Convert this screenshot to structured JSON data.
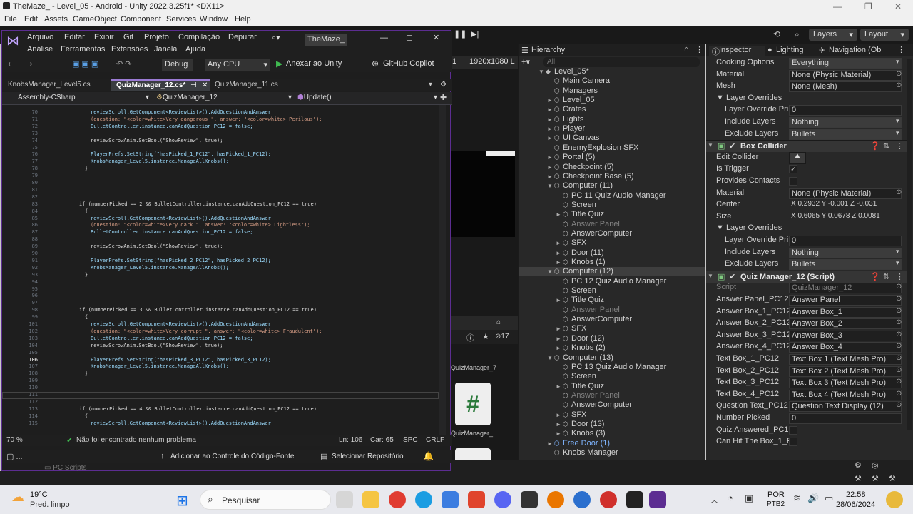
{
  "unity": {
    "title": "TheMaze_ - Level_05 - Android - Unity 2022.3.25f1* <DX11>",
    "menu": [
      "File",
      "Edit",
      "Assets",
      "GameObject",
      "Component",
      "Services",
      "Window",
      "Help"
    ],
    "layers": "Layers",
    "layout": "Layout",
    "resolution": "1920x1080 L",
    "count_badge": "17",
    "project_items": [
      "QuizManager_7",
      "QuizManager_...",
      "PC Scripts"
    ]
  },
  "hierarchy": {
    "tab": "Hierarchy",
    "search_placeholder": "All",
    "items": [
      {
        "label": "Level_05*",
        "indent": 0,
        "arrow": "▼",
        "style": "scene"
      },
      {
        "label": "Main Camera",
        "indent": 1,
        "arrow": "",
        "style": "normal"
      },
      {
        "label": "Managers",
        "indent": 1,
        "arrow": "",
        "style": "normal"
      },
      {
        "label": "Level_05",
        "indent": 1,
        "arrow": "►",
        "style": "normal"
      },
      {
        "label": "Crates",
        "indent": 1,
        "arrow": "►",
        "style": "normal"
      },
      {
        "label": "Lights",
        "indent": 1,
        "arrow": "►",
        "style": "normal"
      },
      {
        "label": "Player",
        "indent": 1,
        "arrow": "►",
        "style": "normal"
      },
      {
        "label": "UI Canvas",
        "indent": 1,
        "arrow": "►",
        "style": "normal"
      },
      {
        "label": "EnemyExplosion SFX",
        "indent": 1,
        "arrow": "",
        "style": "normal"
      },
      {
        "label": "Portal (5)",
        "indent": 1,
        "arrow": "►",
        "style": "normal"
      },
      {
        "label": "Checkpoint (5)",
        "indent": 1,
        "arrow": "►",
        "style": "normal"
      },
      {
        "label": "Checkpoint Base (5)",
        "indent": 1,
        "arrow": "►",
        "style": "normal"
      },
      {
        "label": "Computer (11)",
        "indent": 1,
        "arrow": "▼",
        "style": "normal"
      },
      {
        "label": "PC 11 Quiz Audio Manager",
        "indent": 2,
        "arrow": "",
        "style": "normal"
      },
      {
        "label": "Screen",
        "indent": 2,
        "arrow": "",
        "style": "normal"
      },
      {
        "label": "Title Quiz",
        "indent": 2,
        "arrow": "►",
        "style": "normal"
      },
      {
        "label": "Answer Panel",
        "indent": 2,
        "arrow": "",
        "style": "dim"
      },
      {
        "label": "AnswerComputer",
        "indent": 2,
        "arrow": "",
        "style": "normal"
      },
      {
        "label": "SFX",
        "indent": 2,
        "arrow": "►",
        "style": "normal"
      },
      {
        "label": "Door (11)",
        "indent": 2,
        "arrow": "►",
        "style": "normal"
      },
      {
        "label": "Knobs (1)",
        "indent": 2,
        "arrow": "►",
        "style": "normal"
      },
      {
        "label": "Computer (12)",
        "indent": 1,
        "arrow": "▼",
        "style": "selected"
      },
      {
        "label": "PC 12 Quiz Audio Manager",
        "indent": 2,
        "arrow": "",
        "style": "normal"
      },
      {
        "label": "Screen",
        "indent": 2,
        "arrow": "",
        "style": "normal"
      },
      {
        "label": "Title Quiz",
        "indent": 2,
        "arrow": "►",
        "style": "normal"
      },
      {
        "label": "Answer Panel",
        "indent": 2,
        "arrow": "",
        "style": "dim"
      },
      {
        "label": "AnswerComputer",
        "indent": 2,
        "arrow": "",
        "style": "normal"
      },
      {
        "label": "SFX",
        "indent": 2,
        "arrow": "►",
        "style": "normal"
      },
      {
        "label": "Door (12)",
        "indent": 2,
        "arrow": "►",
        "style": "normal"
      },
      {
        "label": "Knobs (2)",
        "indent": 2,
        "arrow": "►",
        "style": "normal"
      },
      {
        "label": "Computer (13)",
        "indent": 1,
        "arrow": "▼",
        "style": "normal"
      },
      {
        "label": "PC 13 Quiz Audio Manager",
        "indent": 2,
        "arrow": "",
        "style": "normal"
      },
      {
        "label": "Screen",
        "indent": 2,
        "arrow": "",
        "style": "normal"
      },
      {
        "label": "Title Quiz",
        "indent": 2,
        "arrow": "►",
        "style": "normal"
      },
      {
        "label": "Answer Panel",
        "indent": 2,
        "arrow": "",
        "style": "dim"
      },
      {
        "label": "AnswerComputer",
        "indent": 2,
        "arrow": "",
        "style": "normal"
      },
      {
        "label": "SFX",
        "indent": 2,
        "arrow": "►",
        "style": "normal"
      },
      {
        "label": "Door (13)",
        "indent": 2,
        "arrow": "►",
        "style": "normal"
      },
      {
        "label": "Knobs (3)",
        "indent": 2,
        "arrow": "►",
        "style": "normal"
      },
      {
        "label": "Free Door (1)",
        "indent": 1,
        "arrow": "►",
        "style": "prefab"
      },
      {
        "label": "Knobs Manager",
        "indent": 1,
        "arrow": "",
        "style": "normal"
      }
    ]
  },
  "inspector": {
    "tabs": [
      "Inspector",
      "Lighting",
      "Navigation (Ob"
    ],
    "rows": [
      {
        "label": "Cooking Options",
        "value": "Everything",
        "kind": "dropdown",
        "indent": 0
      },
      {
        "label": "Material",
        "value": "None (Physic Material)",
        "kind": "object",
        "indent": 0
      },
      {
        "label": "Mesh",
        "value": "None (Mesh)",
        "kind": "object",
        "indent": 0
      },
      {
        "label": "▼ Layer Overrides",
        "value": "",
        "kind": "header",
        "indent": 0
      },
      {
        "label": "Layer Override Pri",
        "value": "0",
        "kind": "text",
        "indent": 1
      },
      {
        "label": "Include Layers",
        "value": "Nothing",
        "kind": "dropdown",
        "indent": 1
      },
      {
        "label": "Exclude Layers",
        "value": "Bullets",
        "kind": "dropdown",
        "indent": 1
      },
      {
        "label": "Box Collider",
        "value": "",
        "kind": "component",
        "indent": 0
      },
      {
        "label": "Edit Collider",
        "value": "",
        "kind": "editbtn",
        "indent": 0
      },
      {
        "label": "Is Trigger",
        "value": "✓",
        "kind": "check",
        "indent": 0
      },
      {
        "label": "Provides Contacts",
        "value": "",
        "kind": "check",
        "indent": 0
      },
      {
        "label": "Material",
        "value": "None (Physic Material)",
        "kind": "object",
        "indent": 0
      },
      {
        "label": "Center",
        "value": "X 0.2932  Y -0.001  Z -0.031",
        "kind": "vector",
        "indent": 0
      },
      {
        "label": "Size",
        "value": "X 0.6065  Y 0.0678  Z 0.0081",
        "kind": "vector",
        "indent": 0
      },
      {
        "label": "▼ Layer Overrides",
        "value": "",
        "kind": "header",
        "indent": 0
      },
      {
        "label": "Layer Override Pri",
        "value": "0",
        "kind": "text",
        "indent": 1
      },
      {
        "label": "Include Layers",
        "value": "Nothing",
        "kind": "dropdown",
        "indent": 1
      },
      {
        "label": "Exclude Layers",
        "value": "Bullets",
        "kind": "dropdown",
        "indent": 1
      },
      {
        "label": "Quiz Manager_12 (Script)",
        "value": "",
        "kind": "component",
        "indent": 0
      },
      {
        "label": "Script",
        "value": "QuizManager_12",
        "kind": "dimobject",
        "indent": 0
      },
      {
        "label": "Answer Panel_PC12",
        "value": "Answer Panel",
        "kind": "object",
        "indent": 0
      },
      {
        "label": "Answer Box_1_PC12",
        "value": "Answer Box_1",
        "kind": "object",
        "indent": 0
      },
      {
        "label": "Answer Box_2_PC12",
        "value": "Answer Box_2",
        "kind": "object",
        "indent": 0
      },
      {
        "label": "Answer Box_3_PC12",
        "value": "Answer Box_3",
        "kind": "object",
        "indent": 0
      },
      {
        "label": "Answer Box_4_PC12",
        "value": "Answer Box_4",
        "kind": "object",
        "indent": 0
      },
      {
        "label": "Text Box_1_PC12",
        "value": "Text Box 1 (Text Mesh Pro)",
        "kind": "object",
        "indent": 0
      },
      {
        "label": "Text Box_2_PC12",
        "value": "Text Box 2 (Text Mesh Pro)",
        "kind": "object",
        "indent": 0
      },
      {
        "label": "Text Box_3_PC12",
        "value": "Text Box 3 (Text Mesh Pro)",
        "kind": "object",
        "indent": 0
      },
      {
        "label": "Text Box_4_PC12",
        "value": "Text Box 4 (Text Mesh Pro)",
        "kind": "object",
        "indent": 0
      },
      {
        "label": "Question Text_PC12",
        "value": "Question Text Display (12)",
        "kind": "object",
        "indent": 0
      },
      {
        "label": "Number Picked",
        "value": "0",
        "kind": "text",
        "indent": 0
      },
      {
        "label": "Quiz Answered_PC12",
        "value": "",
        "kind": "check",
        "indent": 0
      },
      {
        "label": "Can Hit The Box_1_PC",
        "value": "",
        "kind": "check",
        "indent": 0
      }
    ]
  },
  "vs": {
    "menu1": [
      "Arquivo",
      "Editar",
      "Exibir",
      "Git",
      "Projeto",
      "Compilação",
      "Depurar"
    ],
    "menu2": [
      "Análise",
      "Ferramentas",
      "Extensões",
      "Janela",
      "Ajuda"
    ],
    "solution": "TheMaze_",
    "config": "Debug",
    "platform": "Any CPU",
    "run": "Anexar ao Unity",
    "copilot": "GitHub Copilot",
    "tabs": [
      "KnobsManager_Level5.cs",
      "QuizManager_12.cs*",
      "QuizManager_11.cs"
    ],
    "nav": [
      "Assembly-CSharp",
      "QuizManager_12",
      "Update()"
    ],
    "zoom": "70 %",
    "problems": "Não foi encontrado nenhum problema",
    "ln": "Ln: 106",
    "car": "Car: 65",
    "spc": "SPC",
    "crlf": "CRLF",
    "source_control": "Adicionar ao Controle do Código-Fonte",
    "repo": "Selecionar Repositório",
    "code": [
      {
        "n": "70",
        "t": "reviewScroll.GetComponent<ReviewList>().AddQuestionAndAnswer",
        "i": 2
      },
      {
        "n": "71",
        "t": "(question: \"<color=white>Very dangerous \", answer: \"<color=white> Perilous\");",
        "i": 2
      },
      {
        "n": "72",
        "t": "BulletController.instance.canAddQuestion_PC12 = false;",
        "i": 2
      },
      {
        "n": "73",
        "t": "",
        "i": 2
      },
      {
        "n": "74",
        "t": "reviewScrowAnim.SetBool(\"ShowReview\", true);",
        "i": 2
      },
      {
        "n": "75",
        "t": "",
        "i": 2
      },
      {
        "n": "76",
        "t": "PlayerPrefs.SetString(\"hasPicked_1_PC12\", hasPicked_1_PC12);",
        "i": 2
      },
      {
        "n": "77",
        "t": "KnobsManager_Level5.instance.ManageAllKnobs();",
        "i": 2
      },
      {
        "n": "78",
        "t": "}",
        "i": 1
      },
      {
        "n": "79",
        "t": "",
        "i": 1
      },
      {
        "n": "80",
        "t": "",
        "i": 1
      },
      {
        "n": "81",
        "t": "",
        "i": 1
      },
      {
        "n": "82",
        "t": "",
        "i": 1
      },
      {
        "n": "83",
        "t": "if (numberPicked == 2 && BulletController.instance.canAddQuestion_PC12 == true)",
        "i": 0
      },
      {
        "n": "84",
        "t": "{",
        "i": 1
      },
      {
        "n": "85",
        "t": "reviewScroll.GetComponent<ReviewList>().AddQuestionAndAnswer",
        "i": 2
      },
      {
        "n": "86",
        "t": "(question: \"<color=white>Very dark \", answer: \"<color=white> Lightless\");",
        "i": 2
      },
      {
        "n": "87",
        "t": "BulletController.instance.canAddQuestion_PC12 = false;",
        "i": 2
      },
      {
        "n": "88",
        "t": "",
        "i": 2
      },
      {
        "n": "89",
        "t": "reviewScrowAnim.SetBool(\"ShowReview\", true);",
        "i": 2
      },
      {
        "n": "90",
        "t": "",
        "i": 2
      },
      {
        "n": "91",
        "t": "PlayerPrefs.SetString(\"hasPicked_2_PC12\", hasPicked_2_PC12);",
        "i": 2
      },
      {
        "n": "92",
        "t": "KnobsManager_Level5.instance.ManageAllKnobs();",
        "i": 2
      },
      {
        "n": "93",
        "t": "}",
        "i": 1
      },
      {
        "n": "94",
        "t": "",
        "i": 1
      },
      {
        "n": "95",
        "t": "",
        "i": 1
      },
      {
        "n": "96",
        "t": "",
        "i": 1
      },
      {
        "n": "97",
        "t": "",
        "i": 1
      },
      {
        "n": "98",
        "t": "if (numberPicked == 3 && BulletController.instance.canAddQuestion_PC12 == true)",
        "i": 0
      },
      {
        "n": "99",
        "t": "{",
        "i": 1
      },
      {
        "n": "101",
        "t": "reviewScroll.GetComponent<ReviewList>().AddQuestionAndAnswer",
        "i": 2
      },
      {
        "n": "102",
        "t": "(question: \"<color=white>Very corrupt \", answer: \"<color=white> Fraudulent\");",
        "i": 2
      },
      {
        "n": "103",
        "t": "BulletController.instance.canAddQuestion_PC12 = false;",
        "i": 2
      },
      {
        "n": "104",
        "t": "reviewScrowAnim.SetBool(\"ShowReview\", true);",
        "i": 2
      },
      {
        "n": "105",
        "t": "",
        "i": 2
      },
      {
        "n": "106",
        "t": "PlayerPrefs.SetString(\"hasPicked_3_PC12\", hasPicked_3_PC12);",
        "i": 2
      },
      {
        "n": "107",
        "t": "KnobsManager_Level5.instance.ManageAllKnobs();",
        "i": 2
      },
      {
        "n": "108",
        "t": "}",
        "i": 1
      },
      {
        "n": "109",
        "t": "",
        "i": 1
      },
      {
        "n": "110",
        "t": "",
        "i": 1
      },
      {
        "n": "111",
        "t": "",
        "i": 1
      },
      {
        "n": "112",
        "t": "",
        "i": 1
      },
      {
        "n": "113",
        "t": "if (numberPicked == 4 && BulletController.instance.canAddQuestion_PC12 == true)",
        "i": 0
      },
      {
        "n": "114",
        "t": "{",
        "i": 1
      },
      {
        "n": "115",
        "t": "reviewScroll.GetComponent<ReviewList>().AddQuestionAndAnswer",
        "i": 2
      }
    ]
  },
  "taskbar": {
    "temp": "19°C",
    "weather": "Pred. limpo",
    "search": "Pesquisar",
    "lang1": "POR",
    "lang2": "PTB2",
    "time": "22:58",
    "date": "28/06/2024"
  },
  "colors": {
    "vs_purple": "#5c2d91",
    "unity_blue": "#4a90d9"
  }
}
